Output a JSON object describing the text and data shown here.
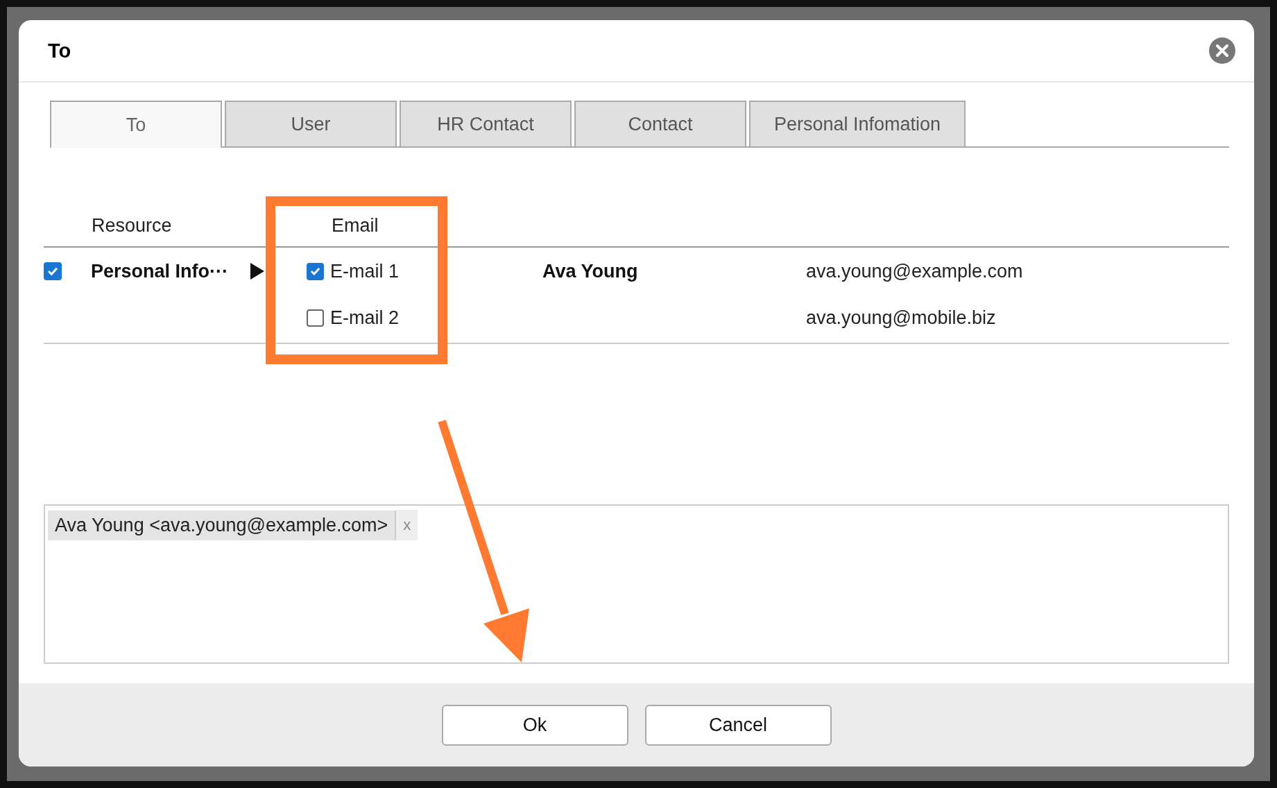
{
  "dialog": {
    "title": "To"
  },
  "tabs": [
    {
      "label": "To",
      "selected": true
    },
    {
      "label": "User",
      "selected": false
    },
    {
      "label": "HR Contact",
      "selected": false
    },
    {
      "label": "Contact",
      "selected": false
    },
    {
      "label": "Personal Infomation",
      "selected": false
    }
  ],
  "table": {
    "columns": [
      "Resource",
      "Email"
    ],
    "rows": [
      {
        "checked": true,
        "resource": "Personal Info···",
        "name": "Ava Young",
        "emails": [
          {
            "label": "E-mail 1",
            "checked": true,
            "address": "ava.young@example.com"
          },
          {
            "label": "E-mail 2",
            "checked": false,
            "address": "ava.young@mobile.biz"
          }
        ]
      }
    ]
  },
  "recipients": [
    {
      "label": "Ava Young <ava.young@example.com>",
      "remove": "x"
    }
  ],
  "buttons": [
    "Ok",
    "Cancel"
  ]
}
